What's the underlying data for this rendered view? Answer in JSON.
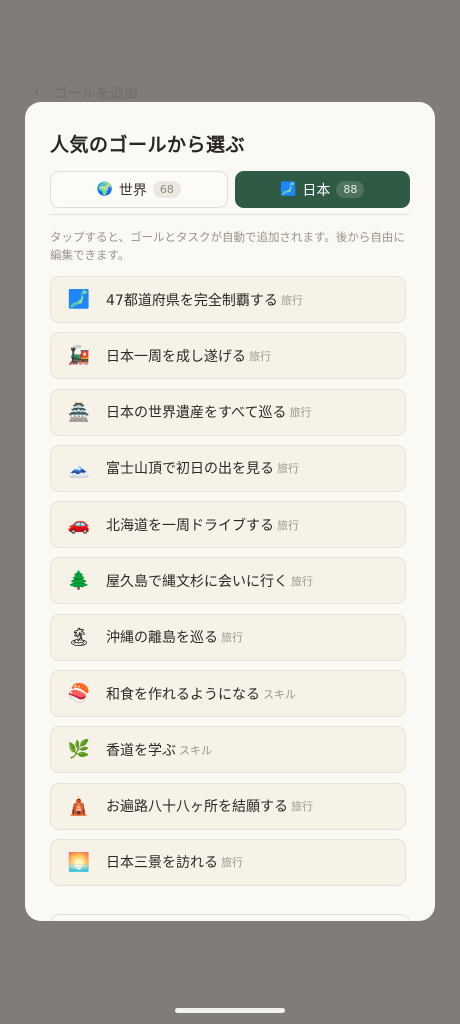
{
  "background": {
    "back_icon": "‹",
    "title": "ゴールを追加"
  },
  "sheet": {
    "title": "人気のゴールから選ぶ",
    "tabs": [
      {
        "flag": "🌍",
        "label": "世界",
        "count": "68",
        "active": false
      },
      {
        "flag": "🗾",
        "label": "日本",
        "count": "88",
        "active": true
      }
    ],
    "description": "タップすると、ゴールとタスクが自動で追加されます。後から自由に編集できます。",
    "goals": [
      {
        "emoji": "🗾",
        "label": "47都道府県を完全制覇する",
        "category": "旅行"
      },
      {
        "emoji": "🚂",
        "label": "日本一周を成し遂げる",
        "category": "旅行"
      },
      {
        "emoji": "🏯",
        "label": "日本の世界遺産をすべて巡る",
        "category": "旅行"
      },
      {
        "emoji": "🗻",
        "label": "富士山頂で初日の出を見る",
        "category": "旅行"
      },
      {
        "emoji": "🚗",
        "label": "北海道を一周ドライブする",
        "category": "旅行"
      },
      {
        "emoji": "🌲",
        "label": "屋久島で縄文杉に会いに行く",
        "category": "旅行"
      },
      {
        "emoji": "🏝",
        "label": "沖縄の離島を巡る",
        "category": "旅行"
      },
      {
        "emoji": "🍣",
        "label": "和食を作れるようになる",
        "category": "スキル"
      },
      {
        "emoji": "🌿",
        "label": "香道を学ぶ",
        "category": "スキル"
      },
      {
        "emoji": "🛕",
        "label": "お遍路八十八ヶ所を結願する",
        "category": "旅行"
      },
      {
        "emoji": "🌅",
        "label": "日本三景を訪れる",
        "category": "旅行"
      }
    ]
  },
  "colors": {
    "overlay": "#807d78",
    "sheet_bg": "#fbf9f4",
    "active_tab": "#2f5b45",
    "row_bg": "#f6f2e7"
  }
}
